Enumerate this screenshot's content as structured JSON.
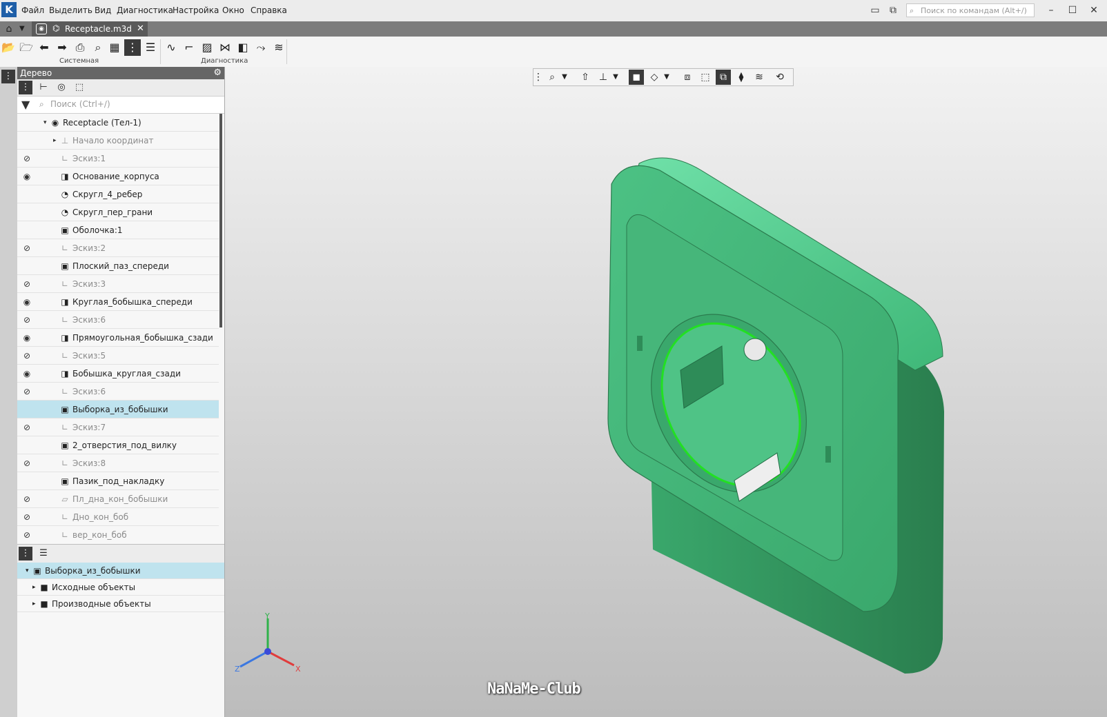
{
  "menubar": {
    "items": [
      "Файл",
      "Выделить",
      "Вид",
      "Диагностика",
      "Настройка",
      "Окно",
      "Справка"
    ],
    "command_search_placeholder": "Поиск по командам (Alt+/)"
  },
  "tabbar": {
    "doc_tab_label": "Receptacle.m3d",
    "close_glyph": "✕"
  },
  "toolbar": {
    "groups": [
      "Системная",
      "Диагностика"
    ]
  },
  "tree_panel": {
    "title": "Дерево",
    "search_placeholder": "Поиск (Ctrl+/)",
    "rows": [
      {
        "label": "Receptacle (Тел-1)",
        "eye": "",
        "icon": "part-icon",
        "indent": 1,
        "expander": "▾",
        "dim": false,
        "selected": false
      },
      {
        "label": "Начало координат",
        "eye": "",
        "icon": "origin-icon",
        "indent": 2,
        "expander": "▸",
        "dim": true,
        "selected": false
      },
      {
        "label": "Эскиз:1",
        "eye": "hidden",
        "icon": "sketch-icon",
        "indent": 2,
        "expander": "",
        "dim": true,
        "selected": false
      },
      {
        "label": "Основание_корпуса",
        "eye": "visible",
        "icon": "extrude-icon",
        "indent": 2,
        "expander": "",
        "dim": false,
        "selected": false
      },
      {
        "label": "Скругл_4_ребер",
        "eye": "",
        "icon": "fillet-icon",
        "indent": 2,
        "expander": "",
        "dim": false,
        "selected": false
      },
      {
        "label": "Скругл_пер_грани",
        "eye": "",
        "icon": "fillet-icon",
        "indent": 2,
        "expander": "",
        "dim": false,
        "selected": false
      },
      {
        "label": "Оболочка:1",
        "eye": "",
        "icon": "shell-icon",
        "indent": 2,
        "expander": "",
        "dim": false,
        "selected": false
      },
      {
        "label": "Эскиз:2",
        "eye": "hidden",
        "icon": "sketch-icon",
        "indent": 2,
        "expander": "",
        "dim": true,
        "selected": false
      },
      {
        "label": "Плоский_паз_спереди",
        "eye": "",
        "icon": "cut-icon",
        "indent": 2,
        "expander": "",
        "dim": false,
        "selected": false
      },
      {
        "label": "Эскиз:3",
        "eye": "hidden",
        "icon": "sketch-icon",
        "indent": 2,
        "expander": "",
        "dim": true,
        "selected": false
      },
      {
        "label": "Круглая_бобышка_спереди",
        "eye": "visible",
        "icon": "extrude-icon",
        "indent": 2,
        "expander": "",
        "dim": false,
        "selected": false
      },
      {
        "label": "Эскиз:6",
        "eye": "hidden",
        "icon": "sketch-icon",
        "indent": 2,
        "expander": "",
        "dim": true,
        "selected": false
      },
      {
        "label": "Прямоугольная_бобышка_сзади",
        "eye": "visible",
        "icon": "extrude-icon",
        "indent": 2,
        "expander": "",
        "dim": false,
        "selected": false
      },
      {
        "label": "Эскиз:5",
        "eye": "hidden",
        "icon": "sketch-icon",
        "indent": 2,
        "expander": "",
        "dim": true,
        "selected": false
      },
      {
        "label": "Бобышка_круглая_сзади",
        "eye": "visible",
        "icon": "extrude-icon",
        "indent": 2,
        "expander": "",
        "dim": false,
        "selected": false
      },
      {
        "label": "Эскиз:6",
        "eye": "hidden",
        "icon": "sketch-icon",
        "indent": 2,
        "expander": "",
        "dim": true,
        "selected": false
      },
      {
        "label": "Выборка_из_бобышки",
        "eye": "",
        "icon": "cut-icon",
        "indent": 2,
        "expander": "",
        "dim": false,
        "selected": true
      },
      {
        "label": "Эскиз:7",
        "eye": "hidden",
        "icon": "sketch-icon",
        "indent": 2,
        "expander": "",
        "dim": true,
        "selected": false
      },
      {
        "label": "2_отверстия_под_вилку",
        "eye": "",
        "icon": "cut-icon",
        "indent": 2,
        "expander": "",
        "dim": false,
        "selected": false
      },
      {
        "label": "Эскиз:8",
        "eye": "hidden",
        "icon": "sketch-icon",
        "indent": 2,
        "expander": "",
        "dim": true,
        "selected": false
      },
      {
        "label": "Пазик_под_накладку",
        "eye": "",
        "icon": "cut-icon",
        "indent": 2,
        "expander": "",
        "dim": false,
        "selected": false
      },
      {
        "label": "Пл_дна_кон_бобышки",
        "eye": "hidden",
        "icon": "plane-icon",
        "indent": 2,
        "expander": "",
        "dim": true,
        "selected": false
      },
      {
        "label": "Дно_кон_боб",
        "eye": "hidden",
        "icon": "sketch-icon",
        "indent": 2,
        "expander": "",
        "dim": true,
        "selected": false
      },
      {
        "label": "вер_кон_боб",
        "eye": "hidden",
        "icon": "sketch-icon",
        "indent": 2,
        "expander": "",
        "dim": true,
        "selected": false
      }
    ]
  },
  "bottom_panel": {
    "rows": [
      {
        "label": "Выборка_из_бобышки",
        "icon": "cut-icon",
        "expander": "▾",
        "indent": 1,
        "selected": true
      },
      {
        "label": "Исходные объекты",
        "icon": "folder-icon",
        "expander": "▸",
        "indent": 2,
        "selected": false
      },
      {
        "label": "Производные объекты",
        "icon": "folder-icon",
        "expander": "▸",
        "indent": 2,
        "selected": false
      }
    ]
  },
  "viewport": {
    "watermark": "NaNaMe-Club",
    "axes": {
      "x": "X",
      "y": "Y",
      "z": "Z"
    },
    "colors": {
      "part": "#3fb878",
      "part_dark": "#2e8c58",
      "part_light": "#5ad596",
      "highlight": "#22e022"
    }
  }
}
